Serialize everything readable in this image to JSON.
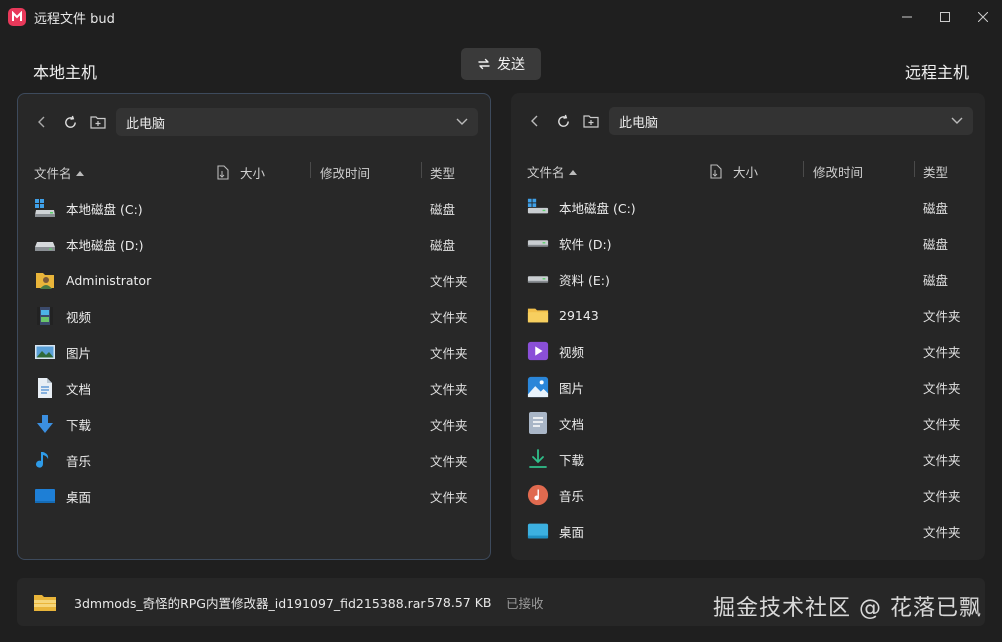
{
  "window": {
    "title": "远程文件 bud",
    "icons": {
      "app": "app-logo-icon",
      "minimize": "minimize-icon",
      "maximize": "maximize-icon",
      "close": "close-icon"
    }
  },
  "header": {
    "local_title": "本地主机",
    "remote_title": "远程主机",
    "send_label": "发送",
    "send_icon": "swap-icon"
  },
  "local": {
    "path": "此电脑",
    "columns": {
      "name": "文件名",
      "size": "大小",
      "modified": "修改时间",
      "type": "类型"
    },
    "items": [
      {
        "name": "本地磁盘 (C:)",
        "type": "磁盘",
        "icon": "system-drive-icon"
      },
      {
        "name": "本地磁盘 (D:)",
        "type": "磁盘",
        "icon": "drive-icon"
      },
      {
        "name": "Administrator",
        "type": "文件夹",
        "icon": "user-folder-icon"
      },
      {
        "name": "视频",
        "type": "文件夹",
        "icon": "video-folder-icon"
      },
      {
        "name": "图片",
        "type": "文件夹",
        "icon": "pictures-folder-icon"
      },
      {
        "name": "文档",
        "type": "文件夹",
        "icon": "documents-folder-icon"
      },
      {
        "name": "下载",
        "type": "文件夹",
        "icon": "download-folder-icon"
      },
      {
        "name": "音乐",
        "type": "文件夹",
        "icon": "music-folder-icon"
      },
      {
        "name": "桌面",
        "type": "文件夹",
        "icon": "desktop-folder-icon"
      }
    ]
  },
  "remote": {
    "path": "此电脑",
    "columns": {
      "name": "文件名",
      "size": "大小",
      "modified": "修改时间",
      "type": "类型"
    },
    "items": [
      {
        "name": "本地磁盘 (C:)",
        "type": "磁盘",
        "icon": "system-drive-icon"
      },
      {
        "name": "软件 (D:)",
        "type": "磁盘",
        "icon": "drive-icon"
      },
      {
        "name": "资料 (E:)",
        "type": "磁盘",
        "icon": "drive-icon"
      },
      {
        "name": "29143",
        "type": "文件夹",
        "icon": "folder-icon"
      },
      {
        "name": "视频",
        "type": "文件夹",
        "icon": "video-folder-icon"
      },
      {
        "name": "图片",
        "type": "文件夹",
        "icon": "pictures-folder-icon"
      },
      {
        "name": "文档",
        "type": "文件夹",
        "icon": "documents-folder-icon"
      },
      {
        "name": "下载",
        "type": "文件夹",
        "icon": "download-folder-icon"
      },
      {
        "name": "音乐",
        "type": "文件夹",
        "icon": "music-folder-icon"
      },
      {
        "name": "桌面",
        "type": "文件夹",
        "icon": "desktop-folder-icon"
      }
    ]
  },
  "transfer": {
    "file_name": "3dmmods_奇怪的RPG内置修改器_id191097_fid215388.rar",
    "size": "578.57 KB",
    "status": "已接收",
    "icon": "archive-icon"
  },
  "watermark": "掘金技术社区 @ 花落已飘",
  "colors": {
    "background": "#1f1f1f",
    "panel": "#282828",
    "accent_border": "#3d4a5c",
    "logo": "#e8395a"
  }
}
